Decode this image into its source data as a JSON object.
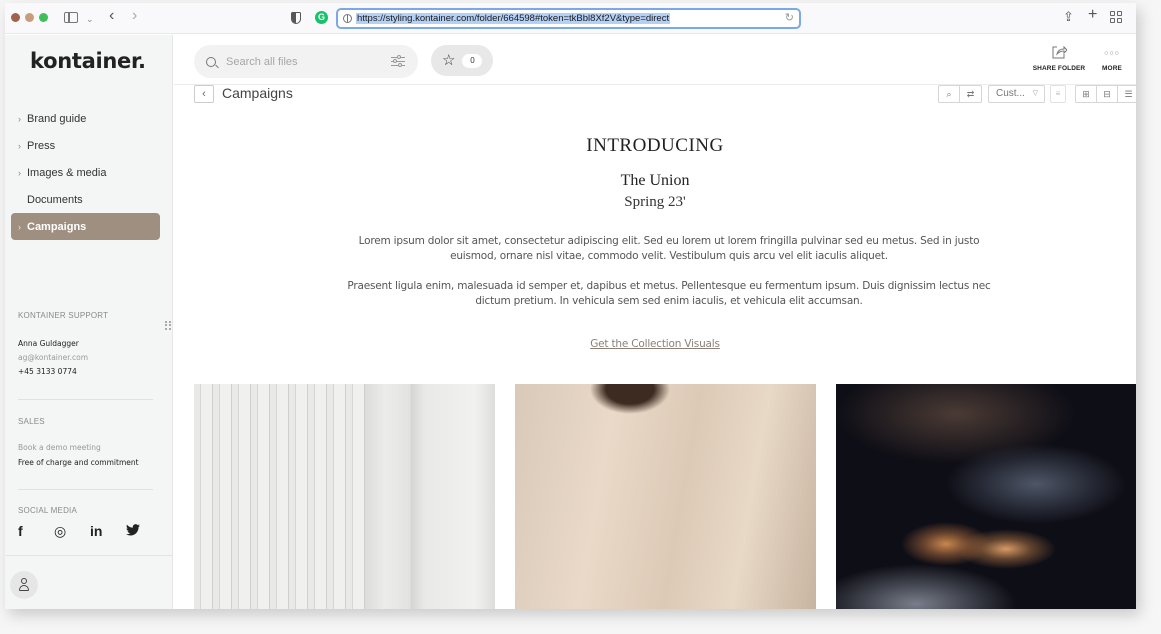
{
  "browser": {
    "url": "https://styling.kontainer.com/folder/664598#token=tkBbl8Xf2V&type=direct",
    "icons": {
      "sidebar_toggle": "sidebar-icon",
      "back": "‹",
      "forward": "›",
      "share": "⇪",
      "new_tab": "+",
      "reload": "↻"
    }
  },
  "sidebar": {
    "logo": "kontainer.",
    "nav": [
      {
        "label": "Brand guide",
        "has_children": true,
        "active": false
      },
      {
        "label": "Press",
        "has_children": true,
        "active": false
      },
      {
        "label": "Images & media",
        "has_children": true,
        "active": false
      },
      {
        "label": "Documents",
        "has_children": false,
        "active": false
      },
      {
        "label": "Campaigns",
        "has_children": true,
        "active": true
      }
    ],
    "support": {
      "heading": "KONTAINER SUPPORT",
      "name": "Anna Guldagger",
      "email": "ag@kontainer.com",
      "phone": "+45 3133 0774"
    },
    "sales": {
      "heading": "SALES",
      "link": "Book a demo meeting",
      "note": "Free of charge and commitment"
    },
    "social": {
      "heading": "SOCIAL MEDIA",
      "items": [
        {
          "name": "facebook",
          "glyph": "f"
        },
        {
          "name": "instagram",
          "glyph": "◎"
        },
        {
          "name": "linkedin",
          "glyph": "in"
        },
        {
          "name": "twitter",
          "glyph": "🐦"
        }
      ]
    }
  },
  "header": {
    "search_placeholder": "Search all files",
    "favorites_count": "0",
    "share_folder_label": "SHARE FOLDER",
    "more_label": "MORE",
    "share_icon": "⇱",
    "more_icon": "○○○"
  },
  "folder": {
    "title": "Campaigns",
    "sort_label": "Cust...",
    "back_glyph": "‹"
  },
  "content": {
    "heading": "INTRODUCING",
    "title": "The Union",
    "subtitle": "Spring 23'",
    "paragraph1": "Lorem ipsum dolor sit amet, consectetur adipiscing elit. Sed eu lorem ut lorem fringilla pulvinar sed eu metus. Sed in justo euismod, ornare nisl vitae, commodo velit. Vestibulum quis arcu vel elit iaculis aliquet.",
    "paragraph2": "Praesent ligula enim, malesuada id semper et, dapibus et metus. Pellentesque eu fermentum ipsum. Duis dignissim lectus nec dictum pretium. In vehicula sem sed enim iaculis, et vehicula elit accumsan.",
    "cta": "Get the Collection Visuals",
    "gallery": [
      {
        "alt": "White stone columns"
      },
      {
        "alt": "Person in beige shirt"
      },
      {
        "alt": "Blurred glassware close-up"
      }
    ]
  },
  "colors": {
    "accent_active": "#9e8f81",
    "sidebar_bg": "#f4f5f5",
    "link": "#8a8078"
  }
}
